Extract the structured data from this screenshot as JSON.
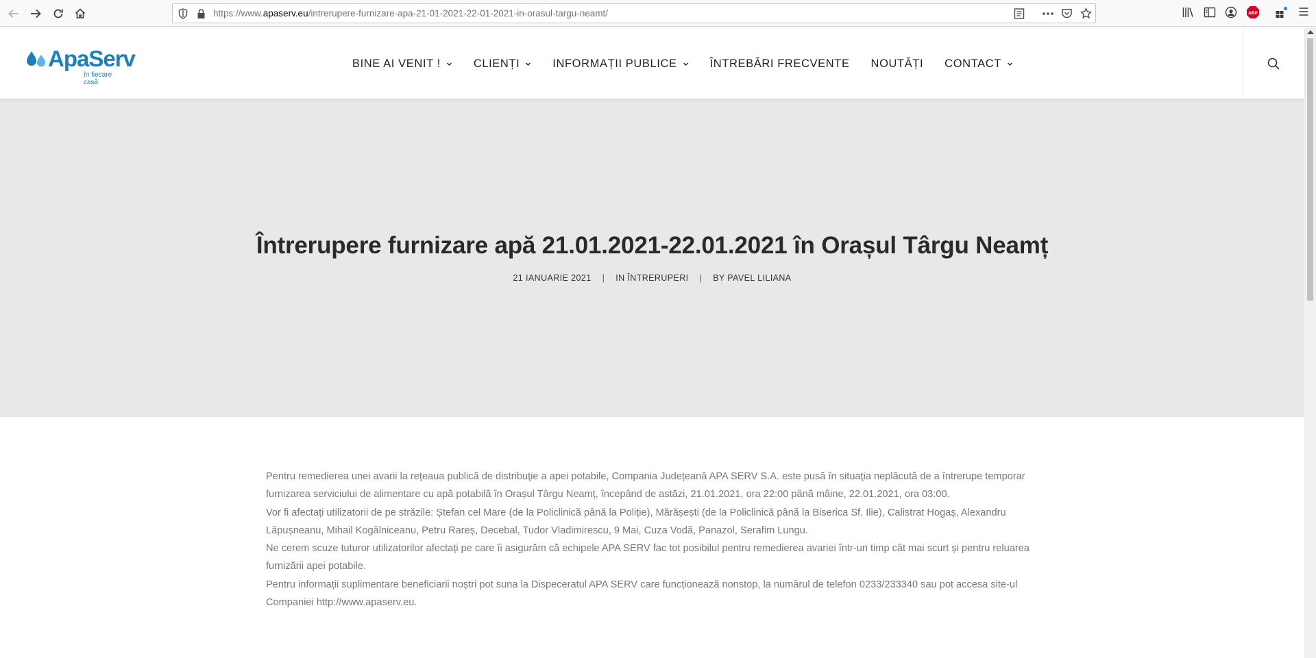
{
  "browser": {
    "url_prefix": "https://www.",
    "url_host": "apaserv.eu",
    "url_path": "/intrerupere-furnizare-apa-21-01-2021-22-01-2021-in-orasul-targu-neamt/",
    "abp_label": "ABP",
    "icons": {
      "back": "back-arrow-icon",
      "forward": "forward-arrow-icon",
      "reload": "reload-icon",
      "home": "home-icon",
      "shield": "tracking-shield-icon",
      "lock": "lock-icon",
      "reader": "reader-view-icon",
      "more": "more-icon",
      "pocket": "pocket-icon",
      "bookmark": "star-icon",
      "library": "library-icon",
      "sidebar": "sidebar-icon",
      "account": "account-icon",
      "adblock": "adblock-icon",
      "extensions": "extensions-icon",
      "menu": "hamburger-menu-icon"
    }
  },
  "site": {
    "logo_text": "ApaServ",
    "logo_tagline": "în fiecare casă",
    "brand_color": "#1d7eb8",
    "nav": [
      {
        "label": "BINE AI VENIT !",
        "has_dropdown": true
      },
      {
        "label": "CLIENȚI",
        "has_dropdown": true
      },
      {
        "label": "INFORMAȚII PUBLICE",
        "has_dropdown": true
      },
      {
        "label": "ÎNTREBĂRI FRECVENTE",
        "has_dropdown": false
      },
      {
        "label": "NOUTĂȚI",
        "has_dropdown": false
      },
      {
        "label": "CONTACT",
        "has_dropdown": true
      }
    ]
  },
  "post": {
    "title": "Întrerupere furnizare apă 21.01.2021-22.01.2021 în Orașul Târgu Neamț",
    "date": "21 IANUARIE 2021",
    "category": "IN ÎNTRERUPERI",
    "author": "BY PAVEL LILIANA",
    "separator": "|",
    "paragraphs": [
      "Pentru remedierea unei avarii la reţeaua publică de distribuţie a apei potabile, Compania Județeană APA SERV S.A. este pusă în situaţia neplăcută de a întrerupe temporar furnizarea serviciului de alimentare cu apă potabilă în Orașul Târgu Neamț, începând de astăzi, 21.01.2021, ora 22:00 până mâine, 22.01.2021, ora 03:00.",
      "Vor fi afectați utilizatorii de pe străzile: Ștefan cel Mare (de la Policlinică până la Poliție), Mărășești (de la Policlinică până la Biserica Sf. Ilie), Calistrat Hogaș, Alexandru Lăpușneanu, Mihail Kogălniceanu, Petru Rareș, Decebal, Tudor Vladimirescu, 9 Mai, Cuza Vodă, Panazol, Serafim Lungu.",
      "Ne cerem scuze tuturor utilizatorilor afectați pe care îi asigurăm că echipele APA SERV fac tot posibilul pentru remedierea avariei într-un timp cât mai scurt și pentru reluarea furnizării apei potabile.",
      "Pentru informații suplimentare beneficiarii noștri pot suna la Dispeceratul APA SERV care funcționează nonstop, la numărul de telefon 0233/233340 sau pot accesa site-ul Companiei http://www.apaserv.eu."
    ]
  }
}
